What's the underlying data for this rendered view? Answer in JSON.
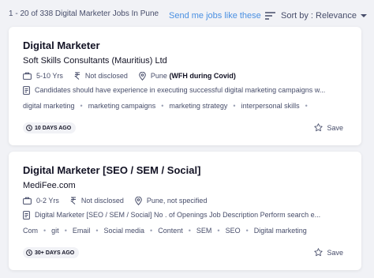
{
  "header": {
    "results_text": "1 - 20 of 338  Digital Marketer Jobs In Pune",
    "send_jobs_link": "Send me jobs like these",
    "sort_label": "Sort by : Relevance",
    "accent_color": "#4a90e2"
  },
  "jobs": [
    {
      "title": "Digital Marketer",
      "company": "Soft Skills Consultants (Mauritius) Ltd",
      "experience": "5-10 Yrs",
      "salary": "Not disclosed",
      "location": "Pune",
      "location_note": "(WFH during Covid)",
      "description": "Candidates should have experience in executing successful digital marketing campaigns w...",
      "tags": [
        "digital marketing",
        "marketing campaigns",
        "marketing strategy",
        "interpersonal skills"
      ],
      "posted": "10 DAYS AGO",
      "save_label": "Save"
    },
    {
      "title": "Digital Marketer [SEO / SEM / Social]",
      "company": "MediFee.com",
      "experience": "0-2 Yrs",
      "salary": "Not disclosed",
      "location": "Pune, not specified",
      "location_note": "",
      "description": "Digital Marketer [SEO / SEM / Social] No . of Openings Job Description Perform search e...",
      "tags": [
        "Com",
        "git",
        "Email",
        "Social media",
        "Content",
        "SEM",
        "SEO",
        "Digital marketing"
      ],
      "posted": "30+ DAYS AGO",
      "save_label": "Save"
    }
  ],
  "icons": {
    "experience": "briefcase-icon",
    "salary": "rupee-icon",
    "location": "location-pin-icon",
    "description": "document-icon",
    "posted": "clock-icon",
    "save": "star-icon",
    "sort": "sort-lines-icon",
    "sort_toggle": "chevron-down-icon"
  }
}
